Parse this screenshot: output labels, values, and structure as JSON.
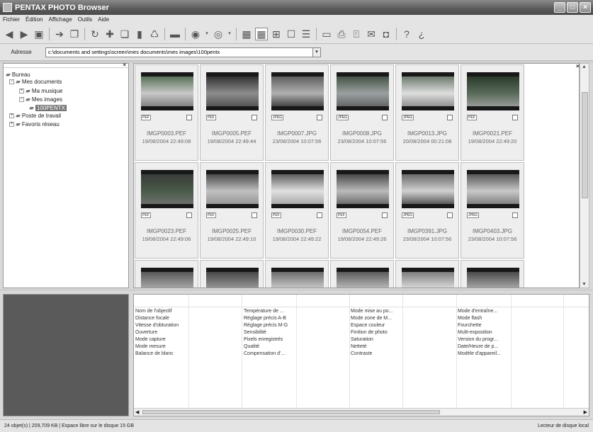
{
  "window": {
    "title": "PENTAX PHOTO Browser"
  },
  "menu": [
    "Fichier",
    "Édition",
    "Affichage",
    "Outils",
    "Aide"
  ],
  "toolbar": {
    "icons": [
      "back-icon",
      "forward-icon",
      "folder-up-icon",
      "move-icon",
      "copy-icon",
      "rotate-icon",
      "crop-icon",
      "copy-file-icon",
      "paste-icon",
      "delete-icon",
      "rename-icon",
      "view-icon",
      "view-dropdown-icon",
      "cd-icon",
      "cd-dropdown-icon",
      "grid-small-icon",
      "grid-medium-icon",
      "grid-large-icon",
      "single-view-icon",
      "list-view-icon",
      "slideshow-icon",
      "print-icon",
      "export-icon",
      "email-icon",
      "camera-icon",
      "help-icon",
      "about-icon"
    ]
  },
  "address": {
    "label": "Adresse",
    "value": "c:\\documents and settings\\screen\\mes documents\\mes images\\100pentx"
  },
  "tree": [
    {
      "label": "Bureau",
      "level": 0,
      "expander": ""
    },
    {
      "label": "Mes documents",
      "level": 1,
      "expander": "−"
    },
    {
      "label": "Ma musique",
      "level": 2,
      "expander": "+"
    },
    {
      "label": "Mes images",
      "level": 2,
      "expander": "−"
    },
    {
      "label": "100PENTX",
      "level": 3,
      "expander": "",
      "selected": true
    },
    {
      "label": "Poste de travail",
      "level": 1,
      "expander": "+"
    },
    {
      "label": "Favoris réseau",
      "level": 1,
      "expander": "+"
    }
  ],
  "thumbnails": [
    {
      "name": "IMGP0003.PEF",
      "date": "19/08/2004 22:49:08",
      "format": "PEF"
    },
    {
      "name": "IMGP0005.PEF",
      "date": "19/08/2004 22:49:44",
      "format": "PEF"
    },
    {
      "name": "IMGP0007.JPG",
      "date": "23/08/2004 10:07:56",
      "format": "JPEG"
    },
    {
      "name": "IMGP0008.JPG",
      "date": "23/08/2004 10:07:56",
      "format": "JPEG"
    },
    {
      "name": "IMGP0013.JPG",
      "date": "20/08/2004 00:21:08",
      "format": "JPEG"
    },
    {
      "name": "IMGP0021.PEF",
      "date": "19/08/2004 22:49:20",
      "format": "PEF"
    },
    {
      "name": "IMGP0023.PEF",
      "date": "19/08/2004 22:49:06",
      "format": "PEF"
    },
    {
      "name": "IMGP0025.PEF",
      "date": "19/08/2004 22:49:10",
      "format": "PEF"
    },
    {
      "name": "IMGP0030.PEF",
      "date": "19/08/2004 22:49:22",
      "format": "PEF"
    },
    {
      "name": "IMGP0054.PEF",
      "date": "19/08/2004 22:49:26",
      "format": "PEF"
    },
    {
      "name": "IMGP0391.JPG",
      "date": "23/08/2004 10:07:56",
      "format": "JPEG"
    },
    {
      "name": "IMGP0403.JPG",
      "date": "23/08/2004 10:07:56",
      "format": "JPEG"
    },
    {
      "name": "",
      "date": "",
      "format": ""
    },
    {
      "name": "",
      "date": "",
      "format": ""
    },
    {
      "name": "",
      "date": "",
      "format": ""
    },
    {
      "name": "",
      "date": "",
      "format": ""
    },
    {
      "name": "",
      "date": "",
      "format": ""
    },
    {
      "name": "",
      "date": "",
      "format": ""
    }
  ],
  "info_columns": [
    [
      "Nom de l'objectif",
      "Distance focale",
      "Vitesse d'obturation",
      "Ouverture",
      "Mode capture",
      "Mode mesure",
      "Balance de blanc"
    ],
    [
      "Température de ...",
      "Réglage précis A-B",
      "Réglage précis M-G",
      "Sensibilité",
      "Pixels enregistrés",
      "Qualité",
      "Compensation d'..."
    ],
    [
      "Mode mise au po...",
      "Mode zone de M...",
      "Espace couleur",
      "Finition de photo",
      "Saturation",
      "Netteté",
      "Contraste"
    ],
    [
      "Mode d'entraîne...",
      "Mode flash",
      "Fourchette",
      "Multi-exposition",
      "Version du progr...",
      "Date/Heure de p...",
      "Modèle d'appareil..."
    ]
  ],
  "status": {
    "left": "24 objet(s) | 209,709 KB | Espace libre sur le disque 15 GB",
    "right": "Lecteur de disque local"
  },
  "colors": {
    "window_bg": "#d9d9d9",
    "titlebar": "#5a5a5a",
    "selected": "#777777"
  }
}
